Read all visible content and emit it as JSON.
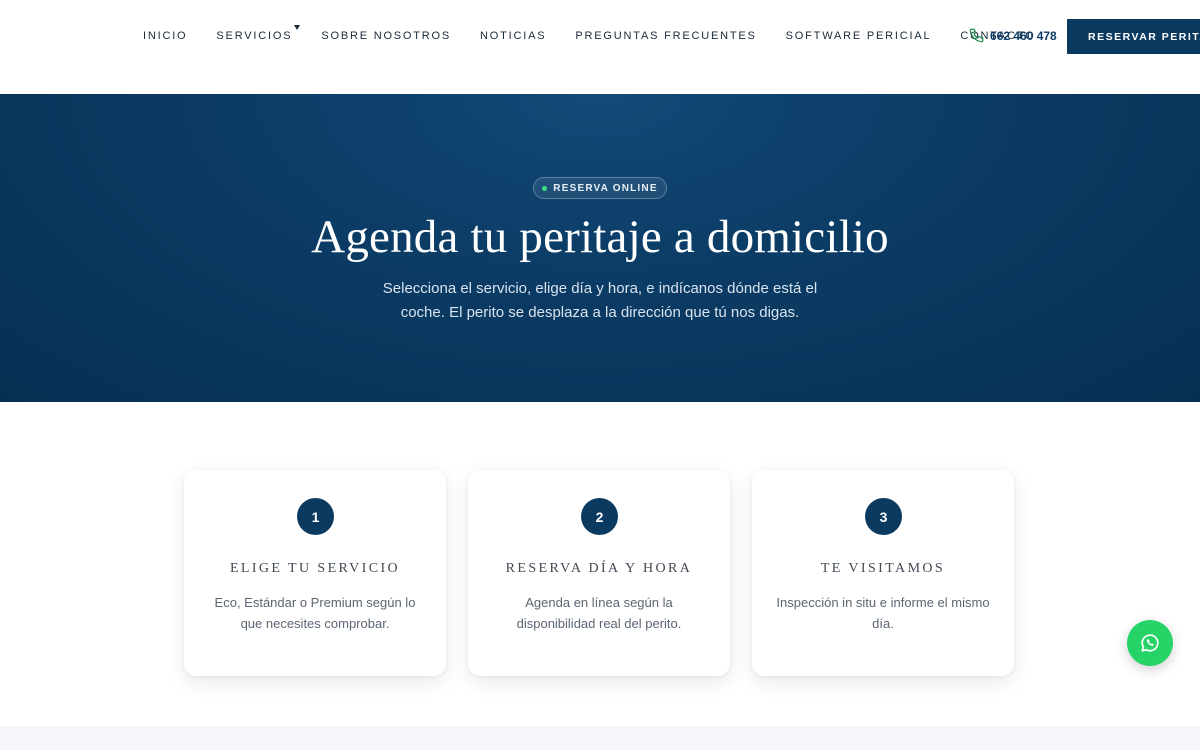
{
  "nav": {
    "items": [
      {
        "label": "INICIO"
      },
      {
        "label": "SERVICIOS"
      },
      {
        "label": "SOBRE NOSOTROS"
      },
      {
        "label": "NOTICIAS"
      },
      {
        "label": "PREGUNTAS FRECUENTES"
      },
      {
        "label": "SOFTWARE PERICIAL"
      },
      {
        "label": "CONTACTO"
      }
    ],
    "phone": "662 460 478",
    "cta_label": "RESERVAR PERITAJE"
  },
  "hero": {
    "badge": "RESERVA ONLINE",
    "title": "Agenda tu peritaje a domicilio",
    "subtitle": "Selecciona el servicio, elige día y hora, e indícanos dónde está el coche. El perito se desplaza a la dirección que tú nos digas."
  },
  "steps": [
    {
      "number": "1",
      "title": "ELIGE TU SERVICIO",
      "text": "Eco, Estándar o Premium según lo que necesites comprobar."
    },
    {
      "number": "2",
      "title": "RESERVA DÍA Y HORA",
      "text": "Agenda en línea según la disponibilidad real del perito."
    },
    {
      "number": "3",
      "title": "TE VISITAMOS",
      "text": "Inspección in situ e informe el mismo día."
    }
  ],
  "icons": {
    "phone": "phone-icon",
    "whatsapp": "whatsapp-icon",
    "dropdown": "chevron-down-icon"
  },
  "colors": {
    "primary": "#0b3a61",
    "hero": "#0c3e68",
    "whatsapp": "#25d366",
    "badge_dot": "#3ddc84"
  }
}
